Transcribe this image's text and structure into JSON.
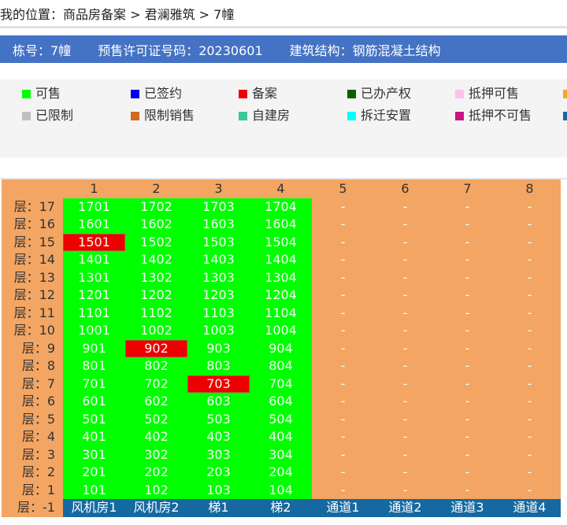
{
  "breadcrumb": "我的位置：商品房备案 > 君澜雅筑 > 7幢",
  "info": {
    "building": "栋号：7幢",
    "permit": "预售许可证号码：20230601",
    "structure": "建筑结构：钢筋混凝土结构"
  },
  "legend": [
    {
      "label": "可售",
      "color": "#00ff00"
    },
    {
      "label": "已签约",
      "color": "#0000ee"
    },
    {
      "label": "备案",
      "color": "#ee0000"
    },
    {
      "label": "已办产权",
      "color": "#006400"
    },
    {
      "label": "抵押可售",
      "color": "#ffc0f0"
    },
    {
      "label": "",
      "color": "#f5a623"
    },
    {
      "label": "已限制",
      "color": "#c0c0c0"
    },
    {
      "label": "限制销售",
      "color": "#d2691e"
    },
    {
      "label": "自建房",
      "color": "#3cc896"
    },
    {
      "label": "拆迁安置",
      "color": "#00ffff"
    },
    {
      "label": "抵押不可售",
      "color": "#c71585"
    },
    {
      "label": "",
      "color": "#1569a0"
    }
  ],
  "table": {
    "columns": [
      "1",
      "2",
      "3",
      "4",
      "5",
      "6",
      "7",
      "8"
    ],
    "floors": [
      {
        "label": "层：17",
        "units": [
          "1701",
          "1702",
          "1703",
          "1704",
          "-",
          "-",
          "-",
          "-"
        ]
      },
      {
        "label": "层：16",
        "units": [
          "1601",
          "1602",
          "1603",
          "1604",
          "-",
          "-",
          "-",
          "-"
        ]
      },
      {
        "label": "层：15",
        "units": [
          "1501",
          "1502",
          "1503",
          "1504",
          "-",
          "-",
          "-",
          "-"
        ]
      },
      {
        "label": "层：14",
        "units": [
          "1401",
          "1402",
          "1403",
          "1404",
          "-",
          "-",
          "-",
          "-"
        ]
      },
      {
        "label": "层：13",
        "units": [
          "1301",
          "1302",
          "1303",
          "1304",
          "-",
          "-",
          "-",
          "-"
        ]
      },
      {
        "label": "层：12",
        "units": [
          "1201",
          "1202",
          "1203",
          "1204",
          "-",
          "-",
          "-",
          "-"
        ]
      },
      {
        "label": "层：11",
        "units": [
          "1101",
          "1102",
          "1103",
          "1104",
          "-",
          "-",
          "-",
          "-"
        ]
      },
      {
        "label": "层：10",
        "units": [
          "1001",
          "1002",
          "1003",
          "1004",
          "-",
          "-",
          "-",
          "-"
        ]
      },
      {
        "label": "层：9",
        "units": [
          "901",
          "902",
          "903",
          "904",
          "-",
          "-",
          "-",
          "-"
        ]
      },
      {
        "label": "层：8",
        "units": [
          "801",
          "802",
          "803",
          "804",
          "-",
          "-",
          "-",
          "-"
        ]
      },
      {
        "label": "层：7",
        "units": [
          "701",
          "702",
          "703",
          "704",
          "-",
          "-",
          "-",
          "-"
        ]
      },
      {
        "label": "层：6",
        "units": [
          "601",
          "602",
          "603",
          "604",
          "-",
          "-",
          "-",
          "-"
        ]
      },
      {
        "label": "层：5",
        "units": [
          "501",
          "502",
          "503",
          "504",
          "-",
          "-",
          "-",
          "-"
        ]
      },
      {
        "label": "层：4",
        "units": [
          "401",
          "402",
          "403",
          "404",
          "-",
          "-",
          "-",
          "-"
        ]
      },
      {
        "label": "层：3",
        "units": [
          "301",
          "302",
          "303",
          "304",
          "-",
          "-",
          "-",
          "-"
        ]
      },
      {
        "label": "层：2",
        "units": [
          "201",
          "202",
          "203",
          "204",
          "-",
          "-",
          "-",
          "-"
        ]
      },
      {
        "label": "层：1",
        "units": [
          "101",
          "102",
          "103",
          "104",
          "-",
          "-",
          "-",
          "-"
        ]
      }
    ],
    "filed_units": [
      "1501",
      "902",
      "703"
    ],
    "basement": {
      "label": "层：-1",
      "units": [
        "风机房1",
        "风机房2",
        "梯1",
        "梯2",
        "通道1",
        "通道2",
        "通道3",
        "通道4"
      ]
    }
  }
}
